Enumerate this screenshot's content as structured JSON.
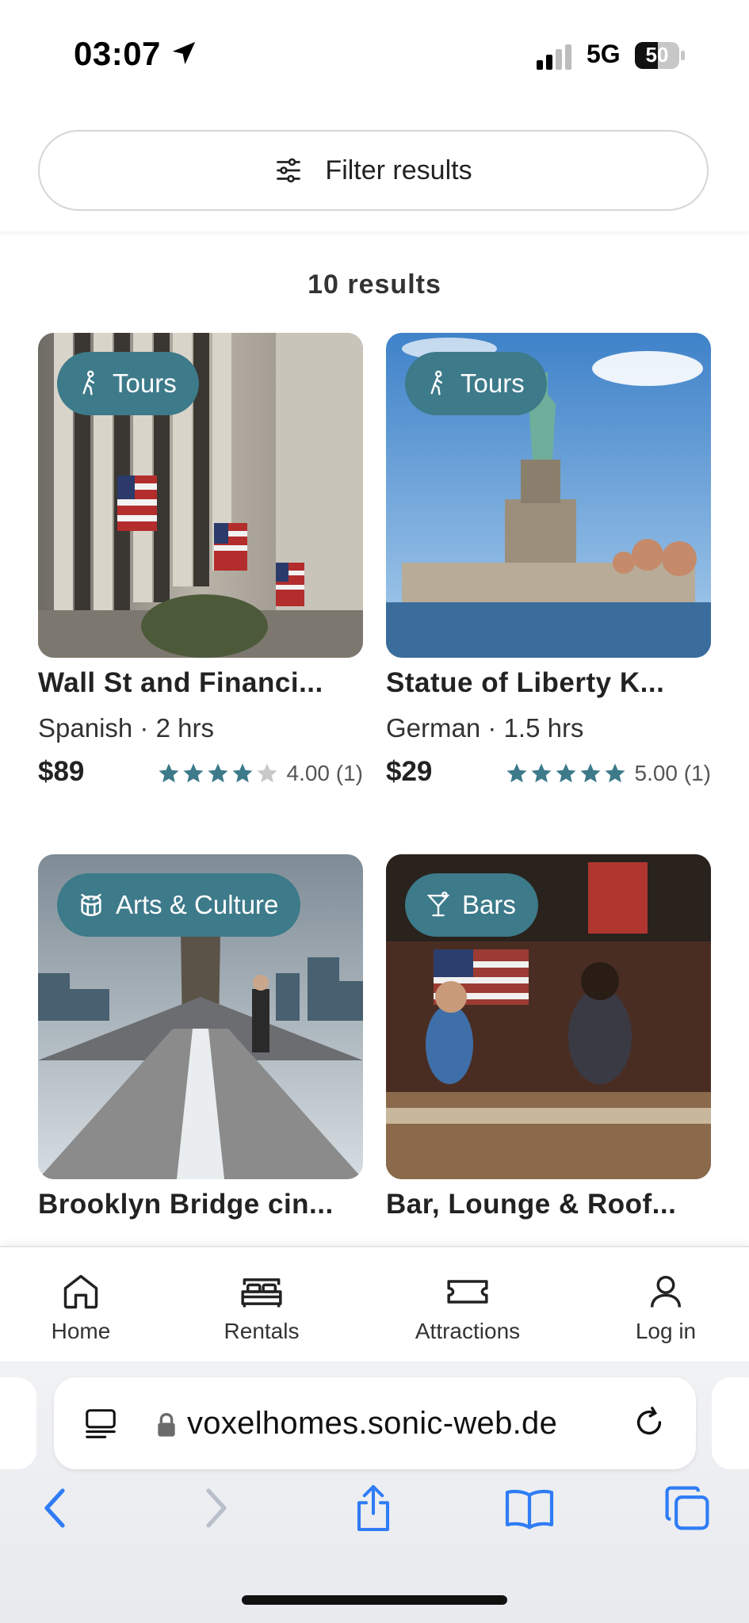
{
  "status_bar": {
    "time": "03:07",
    "network": "5G",
    "battery": "50"
  },
  "filter": {
    "label": "Filter results"
  },
  "results": {
    "count_text": "10 results"
  },
  "cards": [
    {
      "category": "Tours",
      "category_icon": "walking-icon",
      "title": "Wall St and Financi...",
      "language": "Spanish",
      "duration": "2 hrs",
      "price": "$89",
      "rating": 4,
      "rating_text": "4.00 (1)"
    },
    {
      "category": "Tours",
      "category_icon": "walking-icon",
      "title": "Statue of Liberty K...",
      "language": "German",
      "duration": "1.5 hrs",
      "price": "$29",
      "rating": 5,
      "rating_text": "5.00 (1)"
    },
    {
      "category": "Arts & Culture",
      "category_icon": "drum-icon",
      "title": "Brooklyn Bridge cin..."
    },
    {
      "category": "Bars",
      "category_icon": "cocktail-icon",
      "title": "Bar, Lounge & Roof..."
    }
  ],
  "nav": {
    "items": [
      {
        "label": "Home",
        "icon": "home-icon"
      },
      {
        "label": "Rentals",
        "icon": "bed-icon"
      },
      {
        "label": "Attractions",
        "icon": "ticket-icon"
      },
      {
        "label": "Log in",
        "icon": "user-icon"
      }
    ]
  },
  "browser": {
    "url": "voxelhomes.sonic-web.de"
  },
  "colors": {
    "accent": "#3d7a8a",
    "star_filled": "#3d7a8a",
    "star_empty": "#c8c8c8",
    "ios_blue": "#2f7cf6"
  }
}
